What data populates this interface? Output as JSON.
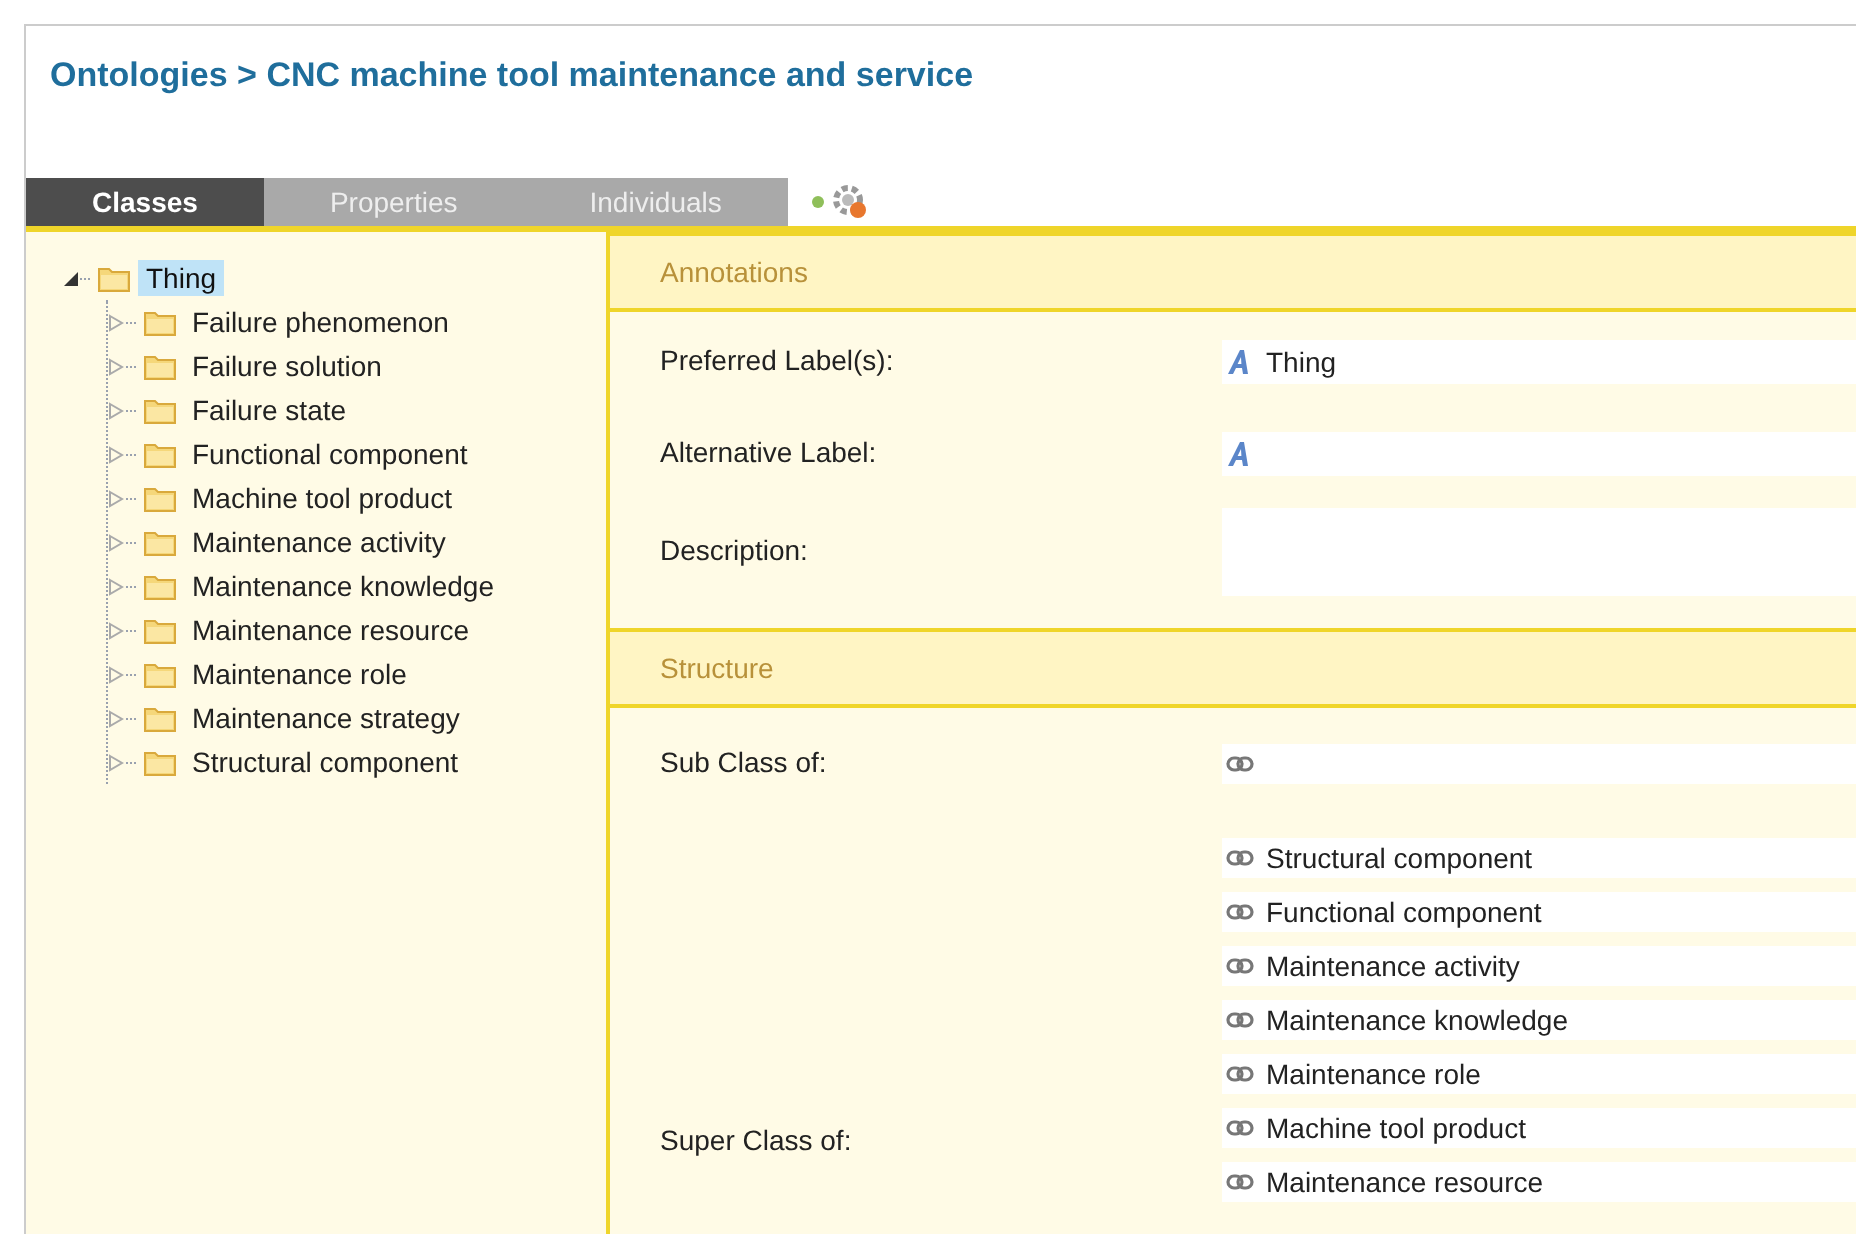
{
  "breadcrumb": {
    "root": "Ontologies",
    "separator": ">",
    "current": "CNC machine tool maintenance and service"
  },
  "tabs": [
    {
      "label": "Classes",
      "selected": true
    },
    {
      "label": "Properties",
      "selected": false
    },
    {
      "label": "Individuals",
      "selected": false
    }
  ],
  "tree": [
    {
      "label": "Thing",
      "selected": true,
      "expanded": true,
      "children": [
        {
          "label": "Failure phenomenon",
          "selected": false,
          "expanded": false
        },
        {
          "label": "Failure solution",
          "selected": false,
          "expanded": false
        },
        {
          "label": "Failure state",
          "selected": false,
          "expanded": false
        },
        {
          "label": "Functional component",
          "selected": false,
          "expanded": false
        },
        {
          "label": "Machine tool product",
          "selected": false,
          "expanded": false
        },
        {
          "label": "Maintenance activity",
          "selected": false,
          "expanded": false
        },
        {
          "label": "Maintenance knowledge",
          "selected": false,
          "expanded": false
        },
        {
          "label": "Maintenance resource",
          "selected": false,
          "expanded": false
        },
        {
          "label": "Maintenance role",
          "selected": false,
          "expanded": false
        },
        {
          "label": "Maintenance strategy",
          "selected": false,
          "expanded": false
        },
        {
          "label": "Structural component",
          "selected": false,
          "expanded": false
        }
      ]
    }
  ],
  "annotations": {
    "title": "Annotations",
    "preferred_label": {
      "label": "Preferred Label(s):",
      "value": "Thing"
    },
    "alternative_label": {
      "label": "Alternative Label:"
    },
    "description": {
      "label": "Description:"
    }
  },
  "structure": {
    "title": "Structure",
    "sub_class_of": {
      "label": "Sub Class of:"
    },
    "super_class_of": {
      "label": "Super Class of:",
      "values": [
        "Structural component",
        "Functional component",
        "Maintenance activity",
        "Maintenance knowledge",
        "Maintenance role",
        "Machine tool product",
        "Maintenance resource"
      ]
    }
  }
}
